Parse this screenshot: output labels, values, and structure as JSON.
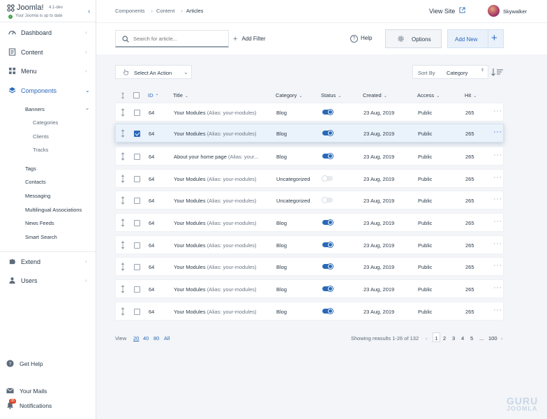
{
  "brand": {
    "name": "Joomla!",
    "version": "4.1-dev",
    "status": "Your Joomla is up to date",
    "status_check": "✓"
  },
  "sidebar": {
    "collapse_icon": "‹",
    "chevron": "›",
    "chevron_open": "⌄",
    "items": [
      {
        "label": "Dashboard",
        "icon": "dashboard-icon"
      },
      {
        "label": "Content",
        "icon": "file-icon"
      },
      {
        "label": "Menu",
        "icon": "grid-icon"
      },
      {
        "label": "Components",
        "icon": "cube-icon"
      }
    ],
    "components_sub": {
      "banners": "Banners",
      "banners_sub": [
        "Categories",
        "Clients",
        "Tracks"
      ],
      "others": [
        "Tags",
        "Contacts",
        "Messaging",
        "Multilingual Associations",
        "News Feeds",
        "Smart Search"
      ]
    },
    "extend": "Extend",
    "users": "Users",
    "bottom": {
      "help": "Get Help",
      "mails": "Your Mails",
      "notifications": "Notifications",
      "notifications_badge": "35"
    }
  },
  "header": {
    "breadcrumbs": [
      "Components",
      "Content",
      "Articles"
    ],
    "breadcrumb_sep": "›",
    "view_site": "View Site",
    "username": "Skywalker"
  },
  "toolbar": {
    "search_placeholder": "Search for article...",
    "add_filter_plus": "+",
    "add_filter": "Add Filter",
    "help_mark": "?",
    "help": "Help",
    "options": "Options",
    "add_new": "Add New",
    "add_new_plus": "+"
  },
  "actions": {
    "select_action": "Select An Action",
    "select_chevron": "⌄",
    "sort_by_label": "Sort By",
    "sort_by_value": "Category",
    "sort_arrows": "⇕"
  },
  "table": {
    "headers": {
      "id": "ID",
      "title": "Title",
      "category": "Category",
      "status": "Status",
      "created": "Created",
      "access": "Access",
      "hit": "Hit"
    },
    "sort_asc_icon": "⌃",
    "sort_icon": "⌄",
    "drag_glyph": "⋮",
    "more_glyph": "···",
    "rows": [
      {
        "id": "64",
        "title": "Your Modules",
        "alias": "(Alias: your-modules)",
        "category": "Blog",
        "published": true,
        "created": "23 Aug, 2019",
        "access": "Public",
        "hit": "265",
        "checked": false
      },
      {
        "id": "64",
        "title": "Your Modules",
        "alias": "(Alias: your-modules)",
        "category": "Blog",
        "published": true,
        "created": "23 Aug, 2019",
        "access": "Public",
        "hit": "265",
        "checked": true
      },
      {
        "id": "64",
        "title": "About your home page",
        "alias": "(Alias: your...",
        "category": "Blog",
        "published": true,
        "created": "23 Aug, 2019",
        "access": "Public",
        "hit": "265",
        "checked": false
      },
      {
        "id": "64",
        "title": "Your Modules",
        "alias": "(Alias: your-modules)",
        "category": "Uncategorized",
        "published": false,
        "created": "23 Aug, 2019",
        "access": "Public",
        "hit": "265",
        "checked": false
      },
      {
        "id": "64",
        "title": "Your Modules",
        "alias": "(Alias: your-modules)",
        "category": "Uncategorized",
        "published": false,
        "created": "23 Aug, 2019",
        "access": "Public",
        "hit": "265",
        "checked": false
      },
      {
        "id": "64",
        "title": "Your Modules",
        "alias": "(Alias: your-modules)",
        "category": "Blog",
        "published": true,
        "created": "23 Aug, 2019",
        "access": "Public",
        "hit": "265",
        "checked": false
      },
      {
        "id": "64",
        "title": "Your Modules",
        "alias": "(Alias: your-modules)",
        "category": "Blog",
        "published": true,
        "created": "23 Aug, 2019",
        "access": "Public",
        "hit": "265",
        "checked": false
      },
      {
        "id": "64",
        "title": "Your Modules",
        "alias": "(Alias: your-modules)",
        "category": "Blog",
        "published": true,
        "created": "23 Aug, 2019",
        "access": "Public",
        "hit": "265",
        "checked": false
      },
      {
        "id": "64",
        "title": "Your Modules",
        "alias": "(Alias: your-modules)",
        "category": "Blog",
        "published": true,
        "created": "23 Aug, 2019",
        "access": "Public",
        "hit": "265",
        "checked": false
      },
      {
        "id": "64",
        "title": "Your Modules",
        "alias": "(Alias: your-modules)",
        "category": "Blog",
        "published": true,
        "created": "23 Aug, 2019",
        "access": "Public",
        "hit": "265",
        "checked": false
      }
    ]
  },
  "pagination": {
    "view_label": "View",
    "limits": [
      "20",
      "40",
      "80",
      "All"
    ],
    "current_limit": "20",
    "showing": "Showing reasults 1-26 of 132",
    "prev": "‹",
    "next": "›",
    "pages": [
      "1",
      "2",
      "3",
      "4",
      "5",
      "...",
      "100"
    ],
    "current_page": "1"
  },
  "watermark": {
    "line1": "GURU",
    "line2": "JOOMLA"
  },
  "colors": {
    "accent": "#2a69b8",
    "success": "#3aa345",
    "badge": "#d9482b"
  }
}
